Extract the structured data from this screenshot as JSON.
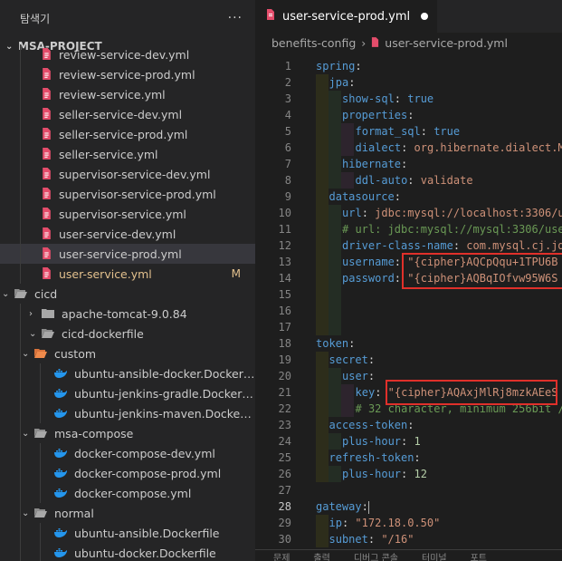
{
  "explorer": {
    "title": "탐색기",
    "more": "···",
    "project": "MSA-PROJECT",
    "items": [
      {
        "label": "review-service-dev.yml",
        "kind": "yml",
        "depth": 1
      },
      {
        "label": "review-service-prod.yml",
        "kind": "yml",
        "depth": 1
      },
      {
        "label": "review-service.yml",
        "kind": "yml",
        "depth": 1
      },
      {
        "label": "seller-service-dev.yml",
        "kind": "yml",
        "depth": 1
      },
      {
        "label": "seller-service-prod.yml",
        "kind": "yml",
        "depth": 1
      },
      {
        "label": "seller-service.yml",
        "kind": "yml",
        "depth": 1
      },
      {
        "label": "supervisor-service-dev.yml",
        "kind": "yml",
        "depth": 1
      },
      {
        "label": "supervisor-service-prod.yml",
        "kind": "yml",
        "depth": 1
      },
      {
        "label": "supervisor-service.yml",
        "kind": "yml",
        "depth": 1
      },
      {
        "label": "user-service-dev.yml",
        "kind": "yml",
        "depth": 1
      },
      {
        "label": "user-service-prod.yml",
        "kind": "yml",
        "depth": 1,
        "selected": true
      },
      {
        "label": "user-service.yml",
        "kind": "yml",
        "depth": 1,
        "modified": true,
        "badge": "M"
      },
      {
        "label": "cicd",
        "kind": "folder-open",
        "depth": 0
      },
      {
        "label": "apache-tomcat-9.0.84",
        "kind": "folder-closed",
        "depth": 1
      },
      {
        "label": "cicd-dockerfile",
        "kind": "folder-open",
        "depth": 1
      },
      {
        "label": "custom",
        "kind": "folder-open-orange",
        "depth": 2
      },
      {
        "label": "ubuntu-ansible-docker.Dockerf...",
        "kind": "docker",
        "depth": 3
      },
      {
        "label": "ubuntu-jenkins-gradle.Dockerfile",
        "kind": "docker",
        "depth": 3
      },
      {
        "label": "ubuntu-jenkins-maven.Dockerf...",
        "kind": "docker",
        "depth": 3
      },
      {
        "label": "msa-compose",
        "kind": "folder-open",
        "depth": 2
      },
      {
        "label": "docker-compose-dev.yml",
        "kind": "docker",
        "depth": 3
      },
      {
        "label": "docker-compose-prod.yml",
        "kind": "docker",
        "depth": 3
      },
      {
        "label": "docker-compose.yml",
        "kind": "docker",
        "depth": 3
      },
      {
        "label": "normal",
        "kind": "folder-open",
        "depth": 2
      },
      {
        "label": "ubuntu-ansible.Dockerfile",
        "kind": "docker",
        "depth": 3
      },
      {
        "label": "ubuntu-docker.Dockerfile",
        "kind": "docker",
        "depth": 3
      }
    ]
  },
  "editor": {
    "tab_label": "user-service-prod.yml",
    "breadcrumb": [
      "benefits-config",
      "user-service-prod.yml"
    ],
    "lines": [
      {
        "n": "1",
        "indent": 0,
        "tokens": [
          {
            "t": "spring",
            "c": "k"
          },
          {
            "t": ":",
            "c": "p"
          }
        ]
      },
      {
        "n": "2",
        "indent": 1,
        "tokens": [
          {
            "t": "jpa",
            "c": "k"
          },
          {
            "t": ":",
            "c": "p"
          }
        ]
      },
      {
        "n": "3",
        "indent": 2,
        "tokens": [
          {
            "t": "show-sql",
            "c": "k"
          },
          {
            "t": ": ",
            "c": "p"
          },
          {
            "t": "true",
            "c": "k"
          }
        ]
      },
      {
        "n": "4",
        "indent": 2,
        "tokens": [
          {
            "t": "properties",
            "c": "k"
          },
          {
            "t": ":",
            "c": "p"
          }
        ]
      },
      {
        "n": "5",
        "indent": 3,
        "tokens": [
          {
            "t": "format_sql",
            "c": "k"
          },
          {
            "t": ": ",
            "c": "p"
          },
          {
            "t": "true",
            "c": "k"
          }
        ]
      },
      {
        "n": "6",
        "indent": 3,
        "tokens": [
          {
            "t": "dialect",
            "c": "k"
          },
          {
            "t": ": ",
            "c": "p"
          },
          {
            "t": "org.hibernate.dialect.M",
            "c": "s"
          }
        ]
      },
      {
        "n": "7",
        "indent": 2,
        "tokens": [
          {
            "t": "hibernate",
            "c": "k"
          },
          {
            "t": ":",
            "c": "p"
          }
        ]
      },
      {
        "n": "8",
        "indent": 3,
        "tokens": [
          {
            "t": "ddl-auto",
            "c": "k"
          },
          {
            "t": ": ",
            "c": "p"
          },
          {
            "t": "validate",
            "c": "s"
          }
        ]
      },
      {
        "n": "9",
        "indent": 1,
        "tokens": [
          {
            "t": "datasource",
            "c": "k"
          },
          {
            "t": ":",
            "c": "p"
          }
        ]
      },
      {
        "n": "10",
        "indent": 2,
        "tokens": [
          {
            "t": "url",
            "c": "k"
          },
          {
            "t": ": ",
            "c": "p"
          },
          {
            "t": "jdbc:mysql://localhost:3306/u",
            "c": "s"
          }
        ]
      },
      {
        "n": "11",
        "indent": 2,
        "tokens": [
          {
            "t": "# url: jdbc:mysql://mysql:3306/use",
            "c": "c"
          }
        ]
      },
      {
        "n": "12",
        "indent": 2,
        "tokens": [
          {
            "t": "driver-class-name",
            "c": "k"
          },
          {
            "t": ": ",
            "c": "p"
          },
          {
            "t": "com.mysql.cj.jd",
            "c": "s"
          }
        ]
      },
      {
        "n": "13",
        "indent": 2,
        "tokens": [
          {
            "t": "username",
            "c": "k"
          },
          {
            "t": ": ",
            "c": "p"
          },
          {
            "t": "\"{cipher}AQCpQqu+1TPU6B",
            "c": "s"
          }
        ]
      },
      {
        "n": "14",
        "indent": 2,
        "tokens": [
          {
            "t": "password",
            "c": "k"
          },
          {
            "t": ": ",
            "c": "p"
          },
          {
            "t": "\"{cipher}AQBqIOfvw95W6S",
            "c": "s"
          }
        ]
      },
      {
        "n": "15",
        "indent": 2,
        "tokens": []
      },
      {
        "n": "16",
        "indent": 2,
        "tokens": []
      },
      {
        "n": "17",
        "indent": 2,
        "tokens": []
      },
      {
        "n": "18",
        "indent": 0,
        "tokens": [
          {
            "t": "token",
            "c": "k"
          },
          {
            "t": ":",
            "c": "p"
          }
        ]
      },
      {
        "n": "19",
        "indent": 1,
        "tokens": [
          {
            "t": "secret",
            "c": "k"
          },
          {
            "t": ":",
            "c": "p"
          }
        ]
      },
      {
        "n": "20",
        "indent": 2,
        "tokens": [
          {
            "t": "user",
            "c": "k"
          },
          {
            "t": ":",
            "c": "p"
          }
        ]
      },
      {
        "n": "21",
        "indent": 3,
        "tokens": [
          {
            "t": "key",
            "c": "k"
          },
          {
            "t": ": ",
            "c": "p"
          },
          {
            "t": "\"{cipher}AQAxjMlRj8mzkAEeS",
            "c": "s"
          }
        ]
      },
      {
        "n": "22",
        "indent": 3,
        "tokens": [
          {
            "t": "# 32 character, minimum 256bit /",
            "c": "c"
          }
        ]
      },
      {
        "n": "23",
        "indent": 1,
        "tokens": [
          {
            "t": "access-token",
            "c": "k"
          },
          {
            "t": ":",
            "c": "p"
          }
        ]
      },
      {
        "n": "24",
        "indent": 2,
        "tokens": [
          {
            "t": "plus-hour",
            "c": "k"
          },
          {
            "t": ": ",
            "c": "p"
          },
          {
            "t": "1",
            "c": "n"
          }
        ]
      },
      {
        "n": "25",
        "indent": 1,
        "tokens": [
          {
            "t": "refresh-token",
            "c": "k"
          },
          {
            "t": ":",
            "c": "p"
          }
        ]
      },
      {
        "n": "26",
        "indent": 2,
        "tokens": [
          {
            "t": "plus-hour",
            "c": "k"
          },
          {
            "t": ": ",
            "c": "p"
          },
          {
            "t": "12",
            "c": "n"
          }
        ]
      },
      {
        "n": "27",
        "indent": 0,
        "tokens": []
      },
      {
        "n": "28",
        "indent": 0,
        "current": true,
        "tokens": [
          {
            "t": "gateway",
            "c": "k"
          },
          {
            "t": ":",
            "c": "p"
          }
        ]
      },
      {
        "n": "29",
        "indent": 1,
        "tokens": [
          {
            "t": "ip",
            "c": "k"
          },
          {
            "t": ": ",
            "c": "p"
          },
          {
            "t": "\"172.18.0.50\"",
            "c": "s"
          }
        ]
      },
      {
        "n": "30",
        "indent": 1,
        "tokens": [
          {
            "t": "subnet",
            "c": "k"
          },
          {
            "t": ": ",
            "c": "p"
          },
          {
            "t": "\"/16\"",
            "c": "s"
          }
        ]
      }
    ]
  },
  "panel": {
    "tabs": [
      "문제",
      "출력",
      "디버그 콘솔",
      "터미널",
      "포트"
    ]
  }
}
